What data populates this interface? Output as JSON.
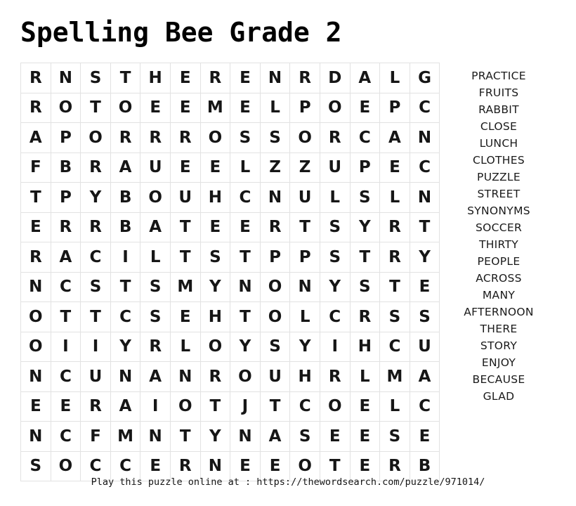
{
  "page": {
    "title": "Spelling Bee Grade 2"
  },
  "grid": {
    "rows": 14,
    "cols": 14,
    "letters": [
      [
        "R",
        "N",
        "S",
        "T",
        "H",
        "E",
        "R",
        "E",
        "N",
        "R",
        "D",
        "A",
        "L",
        "G"
      ],
      [
        "R",
        "O",
        "T",
        "O",
        "E",
        "E",
        "M",
        "E",
        "L",
        "P",
        "O",
        "E",
        "P",
        "C"
      ],
      [
        "A",
        "P",
        "O",
        "R",
        "R",
        "R",
        "O",
        "S",
        "S",
        "O",
        "R",
        "C",
        "A",
        "N"
      ],
      [
        "F",
        "B",
        "R",
        "A",
        "U",
        "E",
        "E",
        "L",
        "Z",
        "Z",
        "U",
        "P",
        "E",
        "C"
      ],
      [
        "T",
        "P",
        "Y",
        "B",
        "O",
        "U",
        "H",
        "C",
        "N",
        "U",
        "L",
        "S",
        "L",
        "N"
      ],
      [
        "E",
        "R",
        "R",
        "B",
        "A",
        "T",
        "E",
        "E",
        "R",
        "T",
        "S",
        "Y",
        "R",
        "T"
      ],
      [
        "R",
        "A",
        "C",
        "I",
        "L",
        "T",
        "S",
        "T",
        "P",
        "P",
        "S",
        "T",
        "R",
        "Y"
      ],
      [
        "N",
        "C",
        "S",
        "T",
        "S",
        "M",
        "Y",
        "N",
        "O",
        "N",
        "Y",
        "S",
        "T",
        "E"
      ],
      [
        "O",
        "T",
        "T",
        "C",
        "S",
        "E",
        "H",
        "T",
        "O",
        "L",
        "C",
        "R",
        "S",
        "S"
      ],
      [
        "O",
        "I",
        "I",
        "Y",
        "R",
        "L",
        "O",
        "Y",
        "S",
        "Y",
        "I",
        "H",
        "C",
        "U"
      ],
      [
        "N",
        "C",
        "U",
        "N",
        "A",
        "N",
        "R",
        "O",
        "U",
        "H",
        "R",
        "L",
        "M",
        "A"
      ],
      [
        "E",
        "E",
        "R",
        "A",
        "I",
        "O",
        "T",
        "J",
        "T",
        "C",
        "O",
        "E",
        "L",
        "C"
      ],
      [
        "N",
        "C",
        "F",
        "M",
        "N",
        "T",
        "Y",
        "N",
        "A",
        "S",
        "E",
        "E",
        "S",
        "E"
      ],
      [
        "S",
        "O",
        "C",
        "C",
        "E",
        "R",
        "N",
        "E",
        "E",
        "O",
        "T",
        "E",
        "R",
        "B"
      ]
    ]
  },
  "word_list": {
    "words": [
      "PRACTICE",
      "FRUITS",
      "RABBIT",
      "CLOSE",
      "LUNCH",
      "CLOTHES",
      "PUZZLE",
      "STREET",
      "SYNONYMS",
      "SOCCER",
      "THIRTY",
      "PEOPLE",
      "ACROSS",
      "MANY",
      "AFTERNOON",
      "THERE",
      "STORY",
      "ENJOY",
      "BECAUSE",
      "GLAD"
    ]
  },
  "footer": {
    "text": "Play this puzzle online at : https://thewordsearch.com/puzzle/971014/"
  }
}
